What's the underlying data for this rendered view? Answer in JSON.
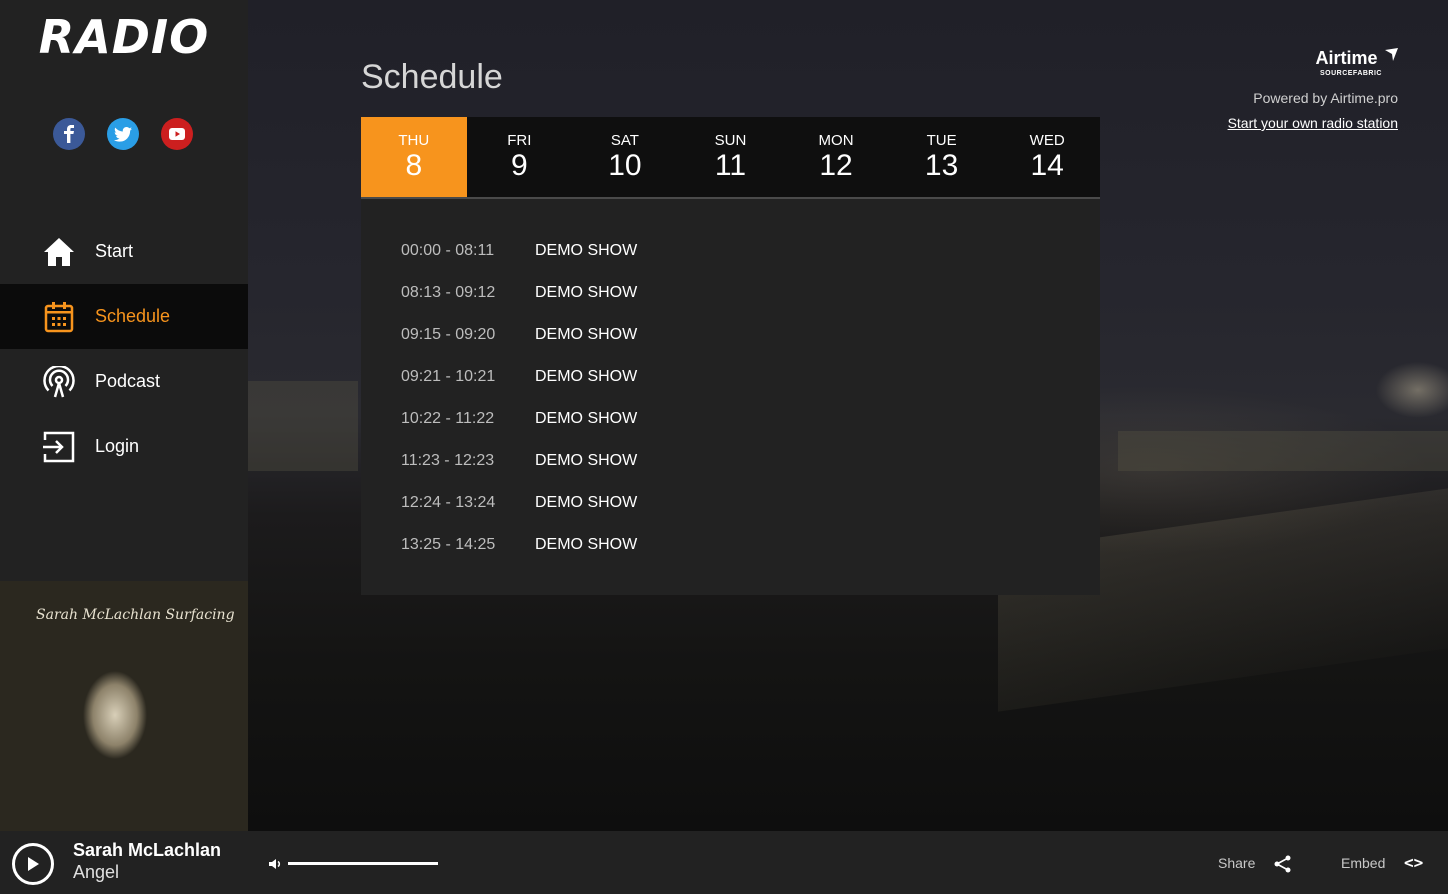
{
  "brand": {
    "logo": "RADIO"
  },
  "social": [
    {
      "name": "facebook",
      "glyph": "f"
    },
    {
      "name": "twitter",
      "glyph": "t"
    },
    {
      "name": "youtube",
      "glyph": "▶"
    }
  ],
  "nav": [
    {
      "label": "Start",
      "icon": "home-icon",
      "active": false
    },
    {
      "label": "Schedule",
      "icon": "calendar-icon",
      "active": true
    },
    {
      "label": "Podcast",
      "icon": "podcast-icon",
      "active": false
    },
    {
      "label": "Login",
      "icon": "login-icon",
      "active": false
    }
  ],
  "album": {
    "signature": "Sarah McLachlan   Surfacing"
  },
  "page": {
    "title": "Schedule"
  },
  "days": [
    {
      "name": "THU",
      "num": "8",
      "active": true
    },
    {
      "name": "FRI",
      "num": "9",
      "active": false
    },
    {
      "name": "SAT",
      "num": "10",
      "active": false
    },
    {
      "name": "SUN",
      "num": "11",
      "active": false
    },
    {
      "name": "MON",
      "num": "12",
      "active": false
    },
    {
      "name": "TUE",
      "num": "13",
      "active": false
    },
    {
      "name": "WED",
      "num": "14",
      "active": false
    }
  ],
  "schedule": [
    {
      "time": "00:00 - 08:11",
      "show": "DEMO SHOW"
    },
    {
      "time": "08:13 - 09:12",
      "show": "DEMO SHOW"
    },
    {
      "time": "09:15 - 09:20",
      "show": "DEMO SHOW"
    },
    {
      "time": "09:21 - 10:21",
      "show": "DEMO SHOW"
    },
    {
      "time": "10:22 - 11:22",
      "show": "DEMO SHOW"
    },
    {
      "time": "11:23 - 12:23",
      "show": "DEMO SHOW"
    },
    {
      "time": "12:24 - 13:24",
      "show": "DEMO SHOW"
    },
    {
      "time": "13:25 - 14:25",
      "show": "DEMO SHOW"
    }
  ],
  "powered": {
    "logo_name": "Airtime",
    "logo_sub": "SOURCEFABRIC",
    "text": "Powered by Airtime.pro",
    "link": "Start your own radio station"
  },
  "player": {
    "artist": "Sarah McLachlan",
    "track": "Angel",
    "volume": 1.0,
    "share_label": "Share",
    "embed_label": "Embed",
    "embed_glyph": "<>"
  },
  "colors": {
    "accent": "#f7941d",
    "sidebar": "#222222",
    "tabs": "#0f0f0f"
  }
}
